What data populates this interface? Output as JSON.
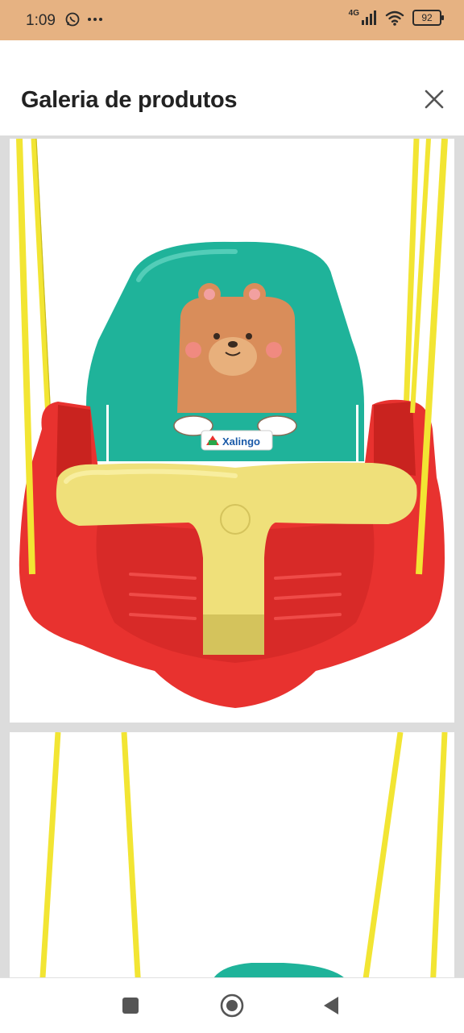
{
  "status_bar": {
    "time": "1:09",
    "left_icons": [
      "whatsapp-icon",
      "more-dots-icon"
    ],
    "network": "4G",
    "battery": "92"
  },
  "header": {
    "title": "Galeria de produtos",
    "close_icon": "close-icon"
  },
  "gallery": {
    "items": [
      {
        "brand_label": "Xalingo",
        "description": "baby swing seat with bear"
      },
      {
        "description": "baby swing seat partial view"
      }
    ]
  },
  "nav_bar": {
    "buttons": [
      "recents-icon",
      "home-icon",
      "back-icon"
    ]
  },
  "colors": {
    "status_bar_bg": "#e6b282",
    "rope_yellow": "#f2e533",
    "seat_red": "#e8322f",
    "backrest_teal": "#1fb39a",
    "bar_yellow": "#efe07a",
    "bear_brown": "#d98d5a"
  }
}
